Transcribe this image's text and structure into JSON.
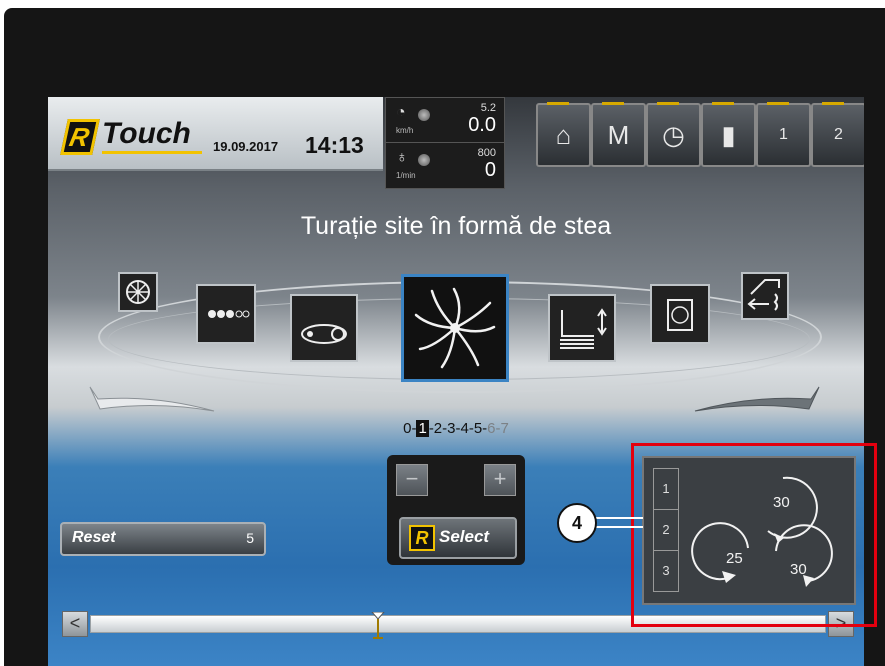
{
  "header": {
    "brand": "Touch",
    "brand_letter": "R",
    "date": "19.09.2017",
    "time": "14:13"
  },
  "gauges": {
    "speed": {
      "unit": "km/h",
      "small": "5.2",
      "big": "0.0"
    },
    "rpm": {
      "unit": "1/min",
      "small": "800",
      "big": "0"
    }
  },
  "nav": {
    "items": [
      {
        "icon": "home-icon",
        "glyph": "⌂"
      },
      {
        "icon": "menu-m-icon",
        "glyph": "M"
      },
      {
        "icon": "stopwatch-icon",
        "glyph": "◷"
      },
      {
        "icon": "bar-chart-icon",
        "glyph": "▮"
      },
      {
        "icon": "window-1-icon",
        "glyph": "1"
      },
      {
        "icon": "window-2-icon",
        "glyph": "2"
      }
    ]
  },
  "title": "Turație site în formă de stea",
  "stepper": {
    "prefix": "0-",
    "selected": "1",
    "middle": "-2-3-4-5-",
    "dim": "6-7"
  },
  "controls": {
    "minus": "−",
    "plus": "+",
    "select_label": "Select",
    "select_logo": "R",
    "reset_label": "Reset",
    "reset_value": "5"
  },
  "popup": {
    "tabs": [
      "1",
      "2",
      "3"
    ],
    "values": [
      "30",
      "25",
      "30"
    ]
  },
  "callout": "4",
  "scroll": {
    "left": "<",
    "right": ">"
  },
  "colors": {
    "accent": "#f2c300",
    "highlight": "#e3000f",
    "active": "#3b84c4"
  }
}
